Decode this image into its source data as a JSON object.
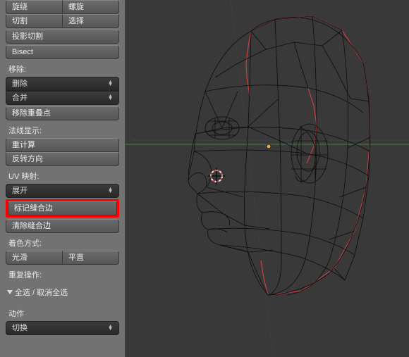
{
  "mesh_tools": {
    "row1": {
      "left": "旋绕",
      "right": "螺旋"
    },
    "row2": {
      "left": "切割",
      "right": "选择"
    },
    "projection_cut": "投影切割",
    "bisect": "Bisect"
  },
  "remove": {
    "label": "移除:",
    "delete": "删除",
    "merge": "合并",
    "remove_doubles": "移除重叠点"
  },
  "normals": {
    "label": "法线显示:",
    "recalc": "重计算",
    "flip": "反转方向"
  },
  "uv": {
    "label": "UV 映射:",
    "unwrap": "展开",
    "mark_seam": "标记缝合边",
    "clear_seam": "清除缝合边"
  },
  "shading": {
    "label": "着色方式:",
    "smooth": "光滑",
    "flat": "平直"
  },
  "repeat": {
    "label": "重复操作:"
  },
  "select_panel": {
    "title": "全选 / 取消全选"
  },
  "action": {
    "label": "动作",
    "value": "切换"
  }
}
